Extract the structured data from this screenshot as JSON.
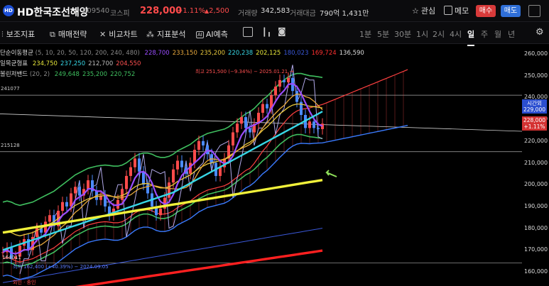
{
  "header": {
    "logo_text": "HD",
    "stock_name": "HD한국조선해양",
    "code": "009540",
    "market": "코스피",
    "price": "228,000",
    "change_pct": "+1.11%",
    "change_arrow": "▲",
    "change_amt": "2,500",
    "volume_label": "거래량",
    "volume": "342,583",
    "amount_label": "거래대금",
    "amount": "790억 1,431만",
    "watch_label": "관심",
    "memo_label": "메모",
    "sell_label": "매수",
    "buy_label": "매도"
  },
  "toolbar": {
    "items": [
      "보조지표",
      "매매전략",
      "비교차트",
      "지표분석",
      "AI예측"
    ],
    "ai_badge": "AI",
    "periods": [
      "1분",
      "5분",
      "30분",
      "1시",
      "2시",
      "4시",
      "일",
      "주",
      "월",
      "년"
    ],
    "active_period": "일"
  },
  "legend": {
    "ma_label": "단순이동평균",
    "ma_params": "(5, 10, 20, 50, 120, 200, 240, 480)",
    "ma_values": [
      "228,700",
      "233,150",
      "235,200",
      "220,238",
      "202,125",
      "180,023",
      "169,724",
      "136,590"
    ],
    "ma_colors": [
      "#9a4dff",
      "#e8a83c",
      "#e8c83c",
      "#37d7e6",
      "#e6e63a",
      "#3a58d8",
      "#ff3030",
      "#dddddd"
    ],
    "ichimoku_label": "일목균형표",
    "ichimoku_values": [
      "234,750",
      "237,250",
      "212,700",
      "204,550"
    ],
    "ichimoku_colors": [
      "#e6e63a",
      "#37d7e6",
      "#bbbbbb",
      "#ff5050"
    ],
    "bb_label": "볼린저밴드",
    "bb_params": "(20, 2)",
    "bb_values": [
      "249,648",
      "235,200",
      "220,752"
    ],
    "bb_colors": [
      "#3fbf5f",
      "#3fbf5f",
      "#3fbf5f"
    ]
  },
  "annotations": {
    "high": "최고 251,500 (−9.34%) − 2025.01.21 →",
    "low": "최저 162,400 (+40.39%) − 2024.09.05",
    "line_241077": "241077",
    "line_215128": "215128",
    "left_bottom_label": "164011",
    "bottom_partial": "외인 · 종인"
  },
  "yaxis": {
    "ticks": [
      "260,000",
      "250,000",
      "240,000",
      "230,000",
      "220,000",
      "210,000",
      "200,000",
      "190,000",
      "180,000",
      "170,000",
      "160,000"
    ],
    "current_tag_label": "시간외",
    "current_tag_price": "229,000",
    "price_tag": "228,000",
    "price_tag_pct": "+1.11%"
  },
  "chart_data": {
    "type": "line",
    "ylim": [
      160000,
      262000
    ],
    "candles_close": [
      169000,
      171000,
      166000,
      167000,
      172000,
      175000,
      170000,
      176000,
      180000,
      178000,
      183000,
      186000,
      181000,
      188000,
      192000,
      190000,
      196000,
      199000,
      195000,
      198000,
      202000,
      197000,
      193000,
      195000,
      190000,
      186000,
      189000,
      193000,
      198000,
      204000,
      208000,
      212000,
      206000,
      200000,
      196000,
      190000,
      186000,
      189000,
      194000,
      201000,
      207000,
      211000,
      208000,
      205000,
      210000,
      216000,
      220000,
      218000,
      214000,
      210000,
      204000,
      208000,
      212000,
      218000,
      224000,
      228000,
      231000,
      226000,
      224000,
      228000,
      233000,
      237000,
      235000,
      241000,
      245000,
      248000,
      247000,
      249000,
      243000,
      238000,
      232000,
      226000,
      229000,
      226000,
      225500,
      228000
    ],
    "ma20": [
      178000,
      178500,
      178000,
      177000,
      176500,
      177000,
      177500,
      178000,
      179000,
      180000,
      181000,
      182000,
      183000,
      184500,
      186000,
      187500,
      189000,
      190500,
      191500,
      192500,
      193500,
      194000,
      194500,
      194800,
      195000,
      194800,
      194500,
      194500,
      195000,
      196000,
      197500,
      199000,
      200000,
      200500,
      200500,
      200000,
      199000,
      198500,
      198500,
      199000,
      200000,
      201500,
      202500,
      203500,
      204500,
      206000,
      207500,
      208500,
      209500,
      210000,
      210500,
      211000,
      211500,
      212500,
      214000,
      215500,
      217000,
      218500,
      219500,
      221000,
      223000,
      225000,
      226500,
      228500,
      230500,
      232500,
      234000,
      235500,
      236500,
      237000,
      237000,
      236500,
      236000,
      235800,
      235500,
      235200
    ],
    "ma120_start": 178000,
    "ma120_end": 202125,
    "ma480_start": 155000,
    "ma480_end": 180023
  }
}
